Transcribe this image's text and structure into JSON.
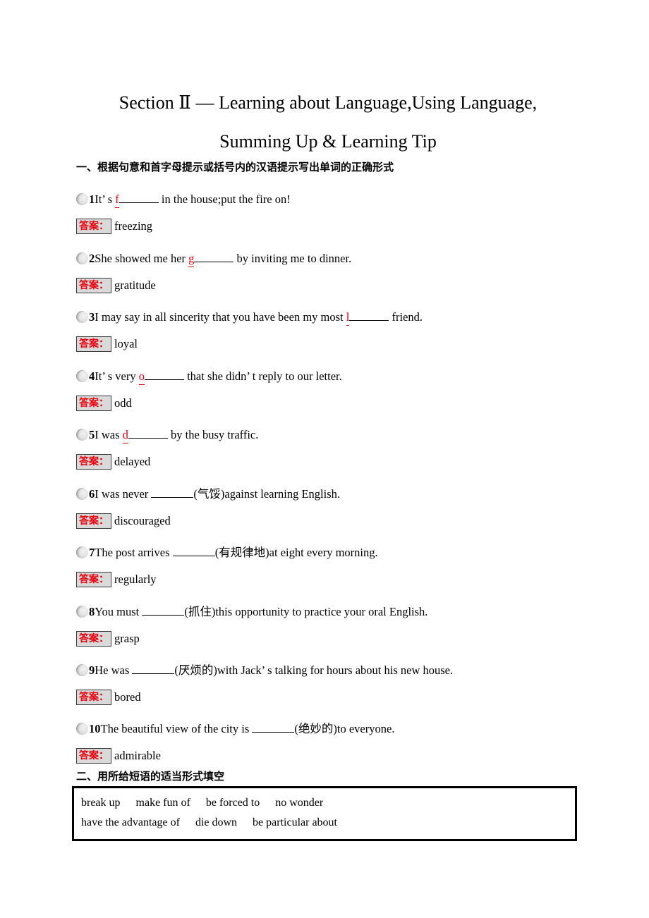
{
  "document": {
    "title_line1": "Section  Ⅱ — Learning about Language,Using Language,",
    "title_line2": "Summing Up & Learning Tip"
  },
  "section_one": {
    "heading": "一、根据句意和首字母提示或括号内的汉语提示写出单词的正确形式",
    "answer_label": "答案：",
    "questions": [
      {
        "number": "1",
        "pre": "It’ s ",
        "hint": "f",
        "post": " in the house;put the fire on!",
        "answer": "freezing"
      },
      {
        "number": "2",
        "pre": "She showed me her ",
        "hint": "g",
        "post": " by inviting me to dinner.",
        "answer": "gratitude"
      },
      {
        "number": "3",
        "pre": "I may say in all sincerity that you have been my most ",
        "hint": "l",
        "post": " friend.",
        "answer": "loyal"
      },
      {
        "number": "4",
        "pre": "It’ s very ",
        "hint": "o",
        "post": " that she didn’ t reply to our letter.",
        "answer": "odd"
      },
      {
        "number": "5",
        "pre": "I was ",
        "hint": "d",
        "post": " by the busy traffic.",
        "answer": "delayed"
      },
      {
        "number": "6",
        "pre": "I was never ",
        "hint": "",
        "post": "(气馁)against learning English.",
        "answer": "discouraged"
      },
      {
        "number": "7",
        "pre": "The post arrives ",
        "hint": "",
        "post": "(有规律地)at eight every morning.",
        "answer": "regularly"
      },
      {
        "number": "8",
        "pre": "You must ",
        "hint": "",
        "post": "(抓住)this opportunity to practice your oral English.",
        "answer": "grasp"
      },
      {
        "number": "9",
        "pre": "He was ",
        "hint": "",
        "post": "(厌烦的)with Jack’ s talking for hours about his new house.",
        "answer": "bored"
      },
      {
        "number": "10",
        "pre": "The beautiful view of the city is ",
        "hint": "",
        "post": "(绝妙的)to everyone.",
        "answer": "admirable"
      }
    ]
  },
  "section_two": {
    "heading": "二、用所给短语的适当形式填空",
    "phrase_box": {
      "line1": [
        "break up",
        "make fun of",
        "be forced to",
        "no wonder"
      ],
      "line2": [
        "have the advantage of",
        "die down",
        "be particular about"
      ]
    }
  },
  "colors": {
    "hint_red": "#e8000d",
    "answer_label_bg": "#d9d9d9",
    "text_black": "#000000"
  }
}
